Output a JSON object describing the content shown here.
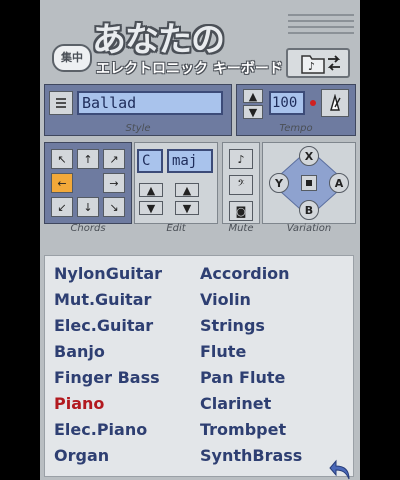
{
  "header": {
    "title": "あなたの",
    "subtitle": "エレクトロニック キーボード",
    "badge": "集中"
  },
  "style": {
    "value": "Ballad",
    "label": "Style"
  },
  "tempo": {
    "value": "100",
    "label": "Tempo"
  },
  "chords": {
    "label": "Chords"
  },
  "edit": {
    "root": "C",
    "quality": "maj",
    "label": "Edit"
  },
  "mute": {
    "label": "Mute"
  },
  "variation": {
    "label": "Variation",
    "x": "X",
    "y": "Y",
    "a": "A",
    "b": "B"
  },
  "instruments": {
    "left": [
      "NylonGuitar",
      "Mut.Guitar",
      "Elec.Guitar",
      "Banjo",
      "Finger Bass",
      "Piano",
      "Elec.Piano",
      "Organ"
    ],
    "right": [
      "Accordion",
      "Violin",
      "Strings",
      "Flute",
      "Pan Flute",
      "Clarinet",
      "Trombpet",
      "SynthBrass"
    ],
    "selected": "Piano"
  },
  "colors": {
    "selected_text": "#b2191f",
    "item_text": "#2e3f72",
    "accent_orange": "#f3a93a",
    "panel_blue": "#6e7ba0"
  }
}
